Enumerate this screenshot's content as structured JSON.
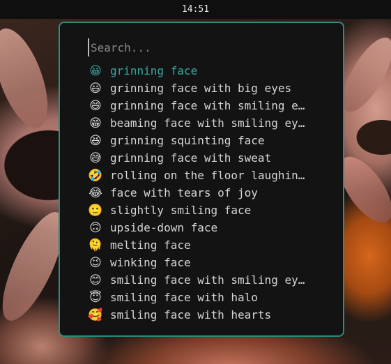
{
  "topbar": {
    "time": "14:51"
  },
  "search": {
    "placeholder": "Search..."
  },
  "items": [
    {
      "emoji": "😀",
      "label": "grinning face",
      "selected": true
    },
    {
      "emoji": "😃",
      "label": "grinning face with big eyes"
    },
    {
      "emoji": "😄",
      "label": "grinning face with smiling e…"
    },
    {
      "emoji": "😁",
      "label": "beaming face with smiling ey…"
    },
    {
      "emoji": "😆",
      "label": "grinning squinting face"
    },
    {
      "emoji": "😅",
      "label": "grinning face with sweat"
    },
    {
      "emoji": "🤣",
      "label": "rolling on the floor laughin…"
    },
    {
      "emoji": "😂",
      "label": "face with tears of joy"
    },
    {
      "emoji": "🙂",
      "label": "slightly smiling face"
    },
    {
      "emoji": "🙃",
      "label": "upside-down face"
    },
    {
      "emoji": "🫠",
      "label": "melting face"
    },
    {
      "emoji": "😉",
      "label": "winking face"
    },
    {
      "emoji": "😊",
      "label": "smiling face with smiling ey…"
    },
    {
      "emoji": "😇",
      "label": "smiling face with halo"
    },
    {
      "emoji": "🥰",
      "label": "smiling face with hearts"
    }
  ],
  "colors": {
    "accent": "#2f8a80",
    "selected_text": "#38a8a0",
    "text": "#d6d6d6",
    "panel_bg": "#131313"
  }
}
